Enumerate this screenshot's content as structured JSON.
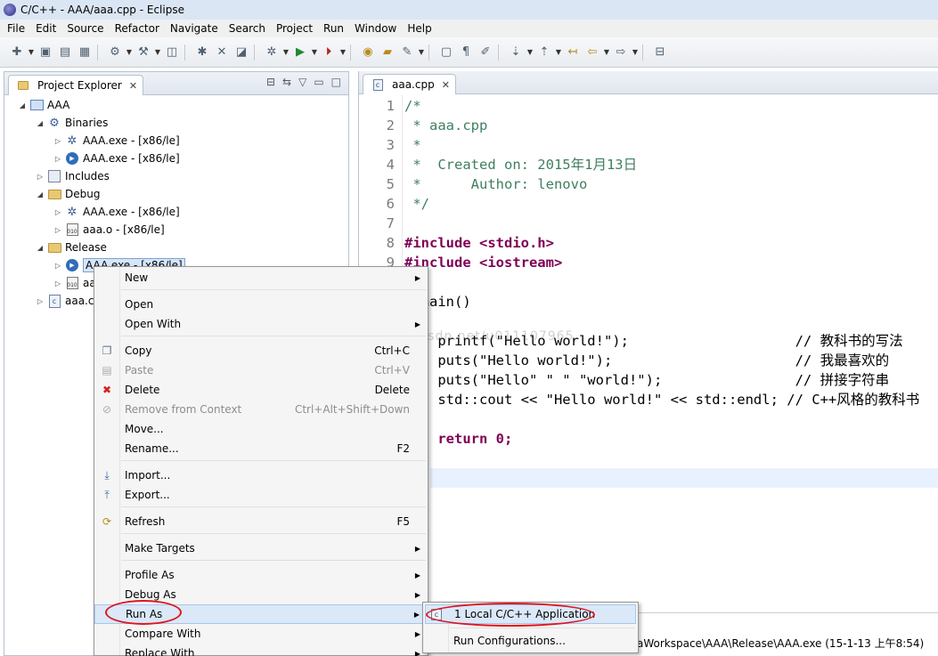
{
  "window": {
    "title": "C/C++ - AAA/aaa.cpp - Eclipse"
  },
  "menubar": [
    "File",
    "Edit",
    "Source",
    "Refactor",
    "Navigate",
    "Search",
    "Project",
    "Run",
    "Window",
    "Help"
  ],
  "explorer": {
    "title": "Project Explorer",
    "tree": [
      {
        "label": "AAA",
        "icon": "project-icon",
        "twisty": "open"
      },
      {
        "label": "Binaries",
        "icon": "binaries-icon",
        "twisty": "open"
      },
      {
        "label": "AAA.exe - [x86/le]",
        "icon": "gear-binary-icon",
        "twisty": "closed"
      },
      {
        "label": "AAA.exe - [x86/le]",
        "icon": "run-binary-icon",
        "twisty": "closed"
      },
      {
        "label": "Includes",
        "icon": "includes-icon",
        "twisty": "closed"
      },
      {
        "label": "Debug",
        "icon": "folder-icon",
        "twisty": "open"
      },
      {
        "label": "AAA.exe - [x86/le]",
        "icon": "gear-binary-icon",
        "twisty": "closed"
      },
      {
        "label": "aaa.o - [x86/le]",
        "icon": "object-file-icon",
        "twisty": "closed"
      },
      {
        "label": "Release",
        "icon": "folder-icon",
        "twisty": "open"
      },
      {
        "label": "AAA.exe - [x86/le]",
        "icon": "run-binary-icon",
        "twisty": "closed"
      },
      {
        "label": "aa",
        "icon": "object-file-icon",
        "twisty": "closed"
      },
      {
        "label": "aaa.c",
        "icon": "c-file-icon",
        "twisty": "closed"
      }
    ]
  },
  "editor": {
    "tab": "aaa.cpp",
    "lines": [
      {
        "n": "1",
        "text": "/*"
      },
      {
        "n": "2",
        "text": " * aaa.cpp"
      },
      {
        "n": "3",
        "text": " *"
      },
      {
        "n": "4",
        "text": " *  Created on: 2015年1月13日"
      },
      {
        "n": "5",
        "text": " *      Author: lenovo"
      },
      {
        "n": "6",
        "text": " */"
      },
      {
        "n": "7",
        "text": ""
      },
      {
        "n": "8",
        "text": "#include <stdio.h>"
      },
      {
        "n": "9",
        "text": "#include <iostream>"
      },
      {
        "n": "",
        "text": "  main()"
      },
      {
        "n": "",
        "text": ""
      },
      {
        "n": "",
        "text": "    printf(\"Hello world!\");                    // 教科书的写法"
      },
      {
        "n": "",
        "text": "    puts(\"Hello world!\");                      // 我最喜欢的"
      },
      {
        "n": "",
        "text": "    puts(\"Hello\" \" \" \"world!\");                // 拼接字符串"
      },
      {
        "n": "",
        "text": "    std::cout << \"Hello world!\" << std::endl; // C++风格的教科书"
      },
      {
        "n": "",
        "text": ""
      },
      {
        "n": "",
        "text": "    return 0;"
      }
    ],
    "console_text": "aWorkspace\\AAA\\Release\\AAA.exe (15-1-13 上午8:54)"
  },
  "watermark": "http://blog.csdn.net/u011107965",
  "context_menu": {
    "items": [
      {
        "label": "New",
        "shortcut": "",
        "submenu": true,
        "disabled": false,
        "icon": ""
      },
      {
        "label": "Open",
        "shortcut": "",
        "submenu": false,
        "disabled": false,
        "icon": ""
      },
      {
        "label": "Open With",
        "shortcut": "",
        "submenu": true,
        "disabled": false,
        "icon": ""
      },
      {
        "label": "Copy",
        "shortcut": "Ctrl+C",
        "submenu": false,
        "disabled": false,
        "icon": "copy-icon"
      },
      {
        "label": "Paste",
        "shortcut": "Ctrl+V",
        "submenu": false,
        "disabled": true,
        "icon": "paste-icon"
      },
      {
        "label": "Delete",
        "shortcut": "Delete",
        "submenu": false,
        "disabled": false,
        "icon": "delete-icon"
      },
      {
        "label": "Remove from Context",
        "shortcut": "Ctrl+Alt+Shift+Down",
        "submenu": false,
        "disabled": true,
        "icon": "remove-context-icon"
      },
      {
        "label": "Move...",
        "shortcut": "",
        "submenu": false,
        "disabled": false,
        "icon": ""
      },
      {
        "label": "Rename...",
        "shortcut": "F2",
        "submenu": false,
        "disabled": false,
        "icon": ""
      },
      {
        "label": "Import...",
        "shortcut": "",
        "submenu": false,
        "disabled": false,
        "icon": "import-icon"
      },
      {
        "label": "Export...",
        "shortcut": "",
        "submenu": false,
        "disabled": false,
        "icon": "export-icon"
      },
      {
        "label": "Refresh",
        "shortcut": "F5",
        "submenu": false,
        "disabled": false,
        "icon": "refresh-icon"
      },
      {
        "label": "Make Targets",
        "shortcut": "",
        "submenu": true,
        "disabled": false,
        "icon": ""
      },
      {
        "label": "Profile As",
        "shortcut": "",
        "submenu": true,
        "disabled": false,
        "icon": ""
      },
      {
        "label": "Debug As",
        "shortcut": "",
        "submenu": true,
        "disabled": false,
        "icon": ""
      },
      {
        "label": "Run As",
        "shortcut": "",
        "submenu": true,
        "disabled": false,
        "icon": ""
      },
      {
        "label": "Compare With",
        "shortcut": "",
        "submenu": true,
        "disabled": false,
        "icon": ""
      },
      {
        "label": "Replace With",
        "shortcut": "",
        "submenu": true,
        "disabled": false,
        "icon": ""
      }
    ]
  },
  "run_as_submenu": {
    "items": [
      {
        "label": "1 Local C/C++ Application",
        "icon": "c-app-icon"
      },
      {
        "label": "Run Configurations...",
        "icon": ""
      }
    ]
  },
  "colors": {
    "annotation_red": "#e0141e",
    "highlight": "#dbe8f8"
  }
}
